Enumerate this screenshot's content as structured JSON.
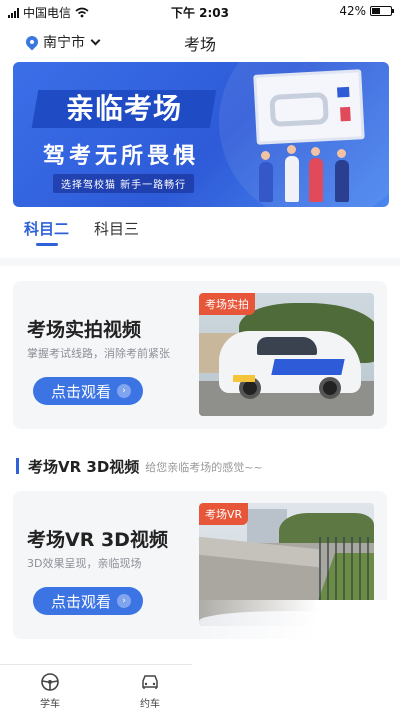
{
  "status_bar": {
    "carrier": "中国电信",
    "time": "下午 2:03",
    "battery_percent": "42%",
    "battery_level": 0.42
  },
  "header": {
    "city": "南宁市",
    "title": "考场"
  },
  "banner": {
    "title": "亲临考场",
    "subtitle": "驾考无所畏惧",
    "tagline": "选择驾校猫 新手一路畅行"
  },
  "tabs": [
    {
      "label": "科目二",
      "active": true
    },
    {
      "label": "科目三",
      "active": false
    }
  ],
  "cards": [
    {
      "title": "考场实拍视频",
      "description": "掌握考试线路，消除考前紧张",
      "button_label": "点击观看",
      "photo_tag": "考场实拍"
    },
    {
      "title": "考场VR 3D视频",
      "description": "3D效果呈现，亲临现场",
      "button_label": "点击观看",
      "photo_tag": "考场VR"
    }
  ],
  "section_vr": {
    "title": "考场VR 3D视频",
    "subtitle": "给您亲临考场的感觉~~"
  },
  "bottom_nav": [
    {
      "label": "学车",
      "icon": "steering-wheel-icon"
    },
    {
      "label": "约车",
      "icon": "car-booking-icon"
    }
  ],
  "colors": {
    "accent": "#2f62d8",
    "button": "#3d74e4",
    "tag": "#e8563a",
    "card_bg": "#f5f6f8"
  }
}
